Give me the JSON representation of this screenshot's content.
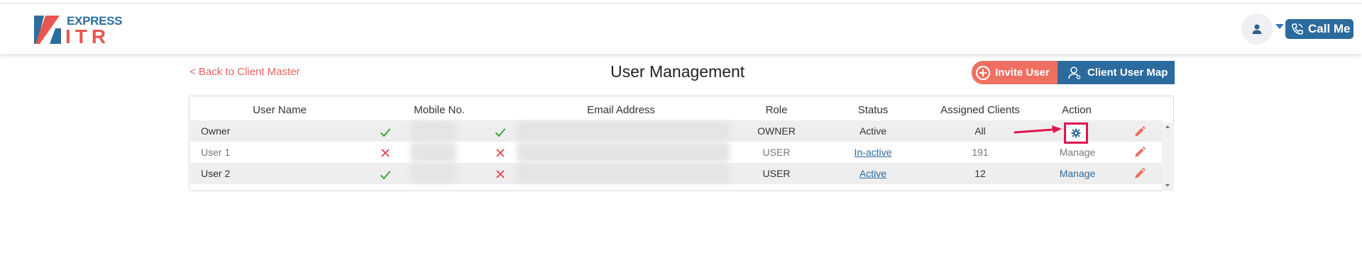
{
  "brand": {
    "top": "EXPRESS",
    "bottom": "ITR"
  },
  "header": {
    "call_me": "Call Me"
  },
  "nav": {
    "back_label": "< Back to Client Master"
  },
  "page": {
    "title": "User Management"
  },
  "actions": {
    "invite_label": "Invite User",
    "map_label": "Client User Map"
  },
  "table": {
    "headers": [
      "User Name",
      "Mobile No.",
      "Email Address",
      "Role",
      "Status",
      "Assigned Clients",
      "Action"
    ],
    "rows": [
      {
        "name": "Owner",
        "mobile_verified": "check",
        "email_verified": "check",
        "role": "OWNER",
        "status": "Active",
        "assigned": "All",
        "action": ""
      },
      {
        "name": "User 1",
        "mobile_verified": "cross",
        "email_verified": "cross",
        "role": "USER",
        "status": "In-active",
        "assigned": "191",
        "action": "Manage"
      },
      {
        "name": "User 2",
        "mobile_verified": "check",
        "email_verified": "cross",
        "role": "USER",
        "status": "Active",
        "assigned": "12",
        "action": "Manage"
      }
    ]
  },
  "colors": {
    "brand_blue": "#2b6b9e",
    "brand_red": "#e5574f",
    "check_green": "#3aa63a",
    "cross_red": "#e5404a",
    "highlight": "#e0144f"
  },
  "icons": {
    "avatar": "user-icon",
    "phone": "phone-icon",
    "invite": "plus-circle-icon",
    "map": "user-outline-icon",
    "settings": "gear-icon",
    "edit": "pencil-icon"
  }
}
